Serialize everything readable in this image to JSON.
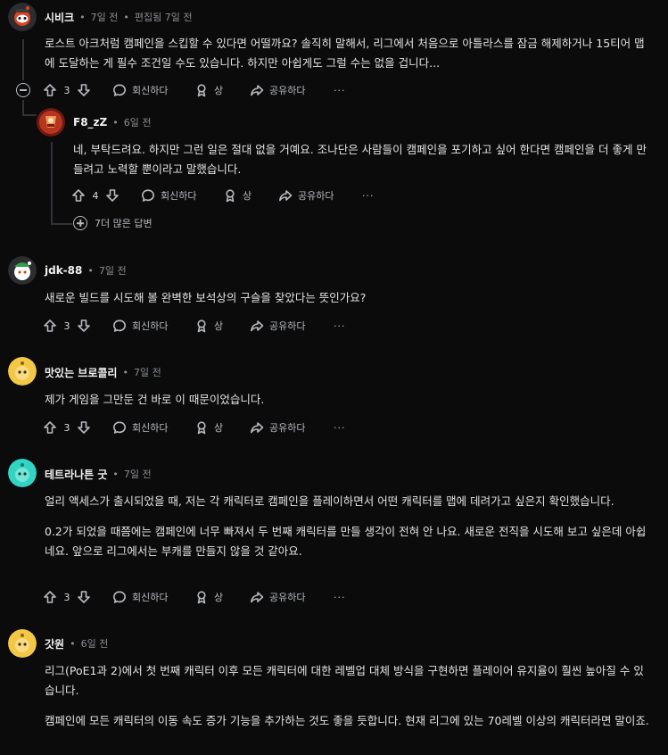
{
  "comments": [
    {
      "author": "시비크",
      "time": "7일 전",
      "edited": "편집됨 7일 전",
      "paragraphs": [
        "로스트 아크처럼 캠페인을 스킵할 수 있다면 어떨까요? 솔직히 말해서, 리그에서 처음으로 아틀라스를 잠금 해제하거나 15티어 맵에 도달하는 게 필수 조건일 수도 있습니다. 하지만 아쉽게도 그럴 수는 없을 겁니다..."
      ],
      "votes": "3"
    },
    {
      "author": "F8_zZ",
      "time": "6일 전",
      "paragraphs": [
        "네, 부탁드려요. 하지만 그런 일은 절대 없을 거예요. 조나단은 사람들이 캠페인을 포기하고 싶어 한다면 캠페인을 더 좋게 만들려고 노력할 뿐이라고 말했습니다."
      ],
      "votes": "4"
    },
    {
      "author": "jdk-88",
      "time": "7일 전",
      "paragraphs": [
        "새로운 빌드를 시도해 볼 완벽한 보석상의 구슬을 찾았다는 뜻인가요?"
      ],
      "votes": "3"
    },
    {
      "author": "맛있는 브로콜리",
      "time": "7일 전",
      "paragraphs": [
        "제가 게임을 그만둔 건 바로 이 때문이었습니다."
      ],
      "votes": "3"
    },
    {
      "author": "테트라나튼 굿",
      "time": "7일 전",
      "paragraphs": [
        "얼리 액세스가 출시되었을 때, 저는 각 캐릭터로 캠페인을 플레이하면서 어떤 캐릭터를 맵에 데려가고 싶은지 확인했습니다.",
        "0.2가 되었을 때쯤에는 캠페인에 너무 빠져서 두 번째 캐릭터를 만들 생각이 전혀 안 나요. 새로운 전직을 시도해 보고 싶은데 아쉽네요. 앞으로 리그에서는 부캐를 만들지 않을 것 같아요."
      ],
      "votes": "3"
    },
    {
      "author": "갓원",
      "time": "6일 전",
      "paragraphs": [
        "리그(PoE1과 2)에서 첫 번째 캐릭터 이후 모든 캐릭터에 대한 레벨업 대체 방식을 구현하면 플레이어 유지율이 훨씬 높아질 수 있습니다.",
        "캠페인에 모든 캐릭터의 이동 속도 증가 기능을 추가하는 것도 좋을 듯합니다. 현재 리그에 있는 70레벨 이상의 캐릭터라면 말이죠."
      ]
    }
  ],
  "labels": {
    "reply": "회신하다",
    "award": "상",
    "share": "공유하다",
    "more": "···",
    "more_replies": "7더 많은 답변",
    "dot": "•"
  },
  "colors": {
    "background": "#0b0b0c",
    "avatar_snoo_red": "#e0401f",
    "avatar_yellow": "#f4c843",
    "avatar_teal": "#2fd6c4"
  }
}
